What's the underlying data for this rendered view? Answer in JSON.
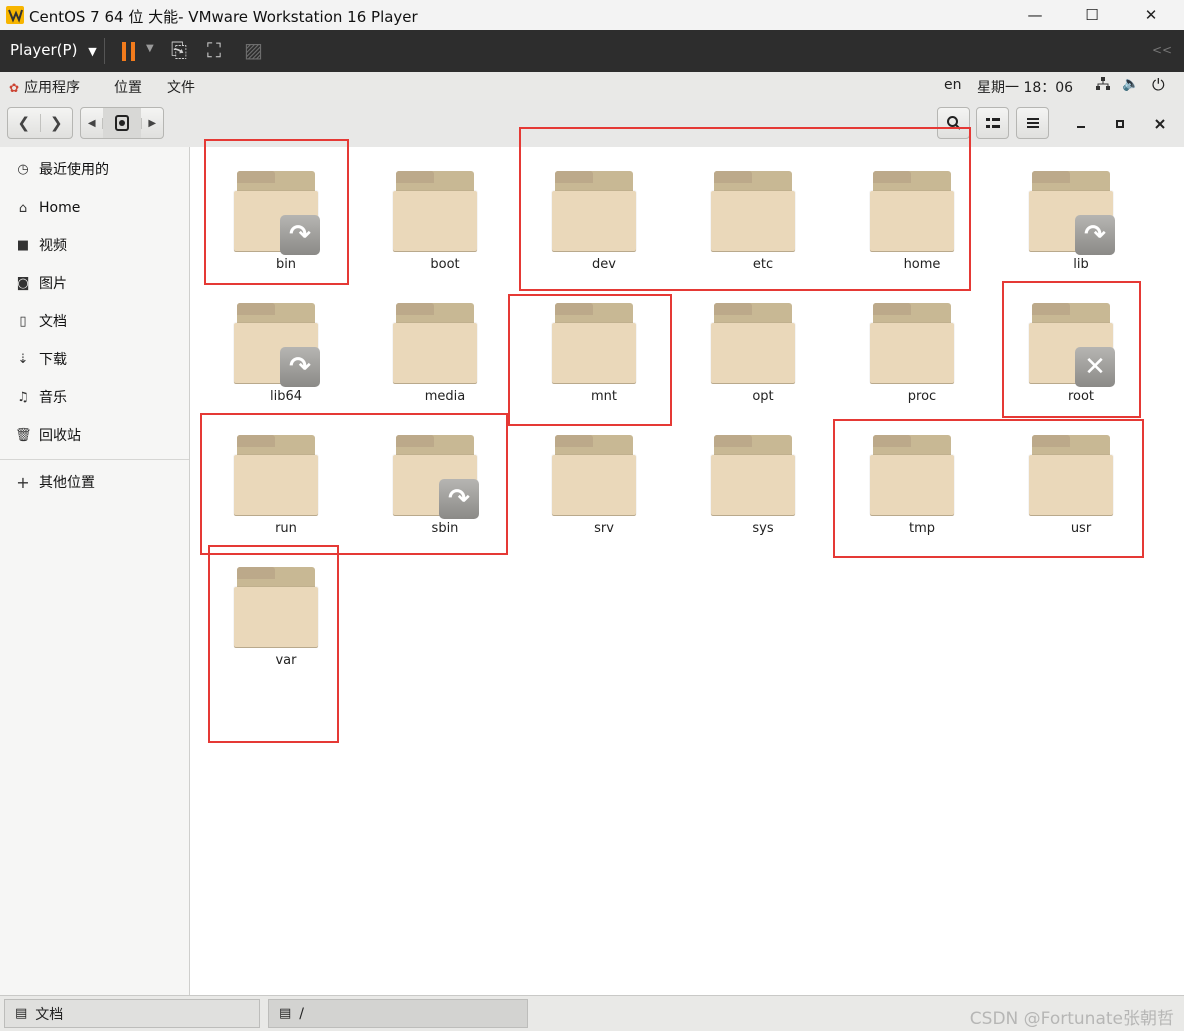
{
  "window": {
    "title": "CentOS 7 64 位 大能- VMware Workstation 16 Player",
    "minimize": "—",
    "maximize": "☐",
    "close": "✕"
  },
  "vm_toolbar": {
    "player_menu": "Player(P)"
  },
  "gnome_bar": {
    "applications": "应用程序",
    "places": "位置",
    "files": "文件",
    "language": "en",
    "clock": "星期一 18：06"
  },
  "sidebar": {
    "items": [
      {
        "label": "最近使用的",
        "icon": "clock-icon"
      },
      {
        "label": "Home",
        "icon": "home-icon"
      },
      {
        "label": "视频",
        "icon": "video-icon"
      },
      {
        "label": "图片",
        "icon": "camera-icon"
      },
      {
        "label": "文档",
        "icon": "document-icon"
      },
      {
        "label": "下载",
        "icon": "download-icon"
      },
      {
        "label": "音乐",
        "icon": "music-icon"
      },
      {
        "label": "回收站",
        "icon": "trash-icon"
      }
    ],
    "other_locations": "其他位置"
  },
  "folders": [
    {
      "name": "bin",
      "emblem": "link"
    },
    {
      "name": "boot",
      "emblem": ""
    },
    {
      "name": "dev",
      "emblem": ""
    },
    {
      "name": "etc",
      "emblem": ""
    },
    {
      "name": "home",
      "emblem": ""
    },
    {
      "name": "lib",
      "emblem": "link"
    },
    {
      "name": "lib64",
      "emblem": "link"
    },
    {
      "name": "media",
      "emblem": ""
    },
    {
      "name": "mnt",
      "emblem": ""
    },
    {
      "name": "opt",
      "emblem": ""
    },
    {
      "name": "proc",
      "emblem": ""
    },
    {
      "name": "root",
      "emblem": "unreadable"
    },
    {
      "name": "run",
      "emblem": ""
    },
    {
      "name": "sbin",
      "emblem": "link"
    },
    {
      "name": "srv",
      "emblem": ""
    },
    {
      "name": "sys",
      "emblem": ""
    },
    {
      "name": "tmp",
      "emblem": ""
    },
    {
      "name": "usr",
      "emblem": ""
    },
    {
      "name": "var",
      "emblem": ""
    }
  ],
  "taskbar": {
    "left_task": "文档",
    "right_task": "/"
  },
  "watermark": "CSDN @Fortunate张朝哲"
}
